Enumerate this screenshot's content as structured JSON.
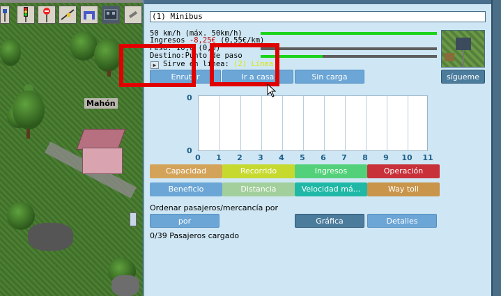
{
  "map": {
    "city_label": "Mahón",
    "toolbar": [
      "road-sign-icon",
      "traffic-light-icon",
      "no-entry-sign-icon",
      "waypoint-icon",
      "depot-icon",
      "station-icon",
      "wrench-icon"
    ]
  },
  "vehicle": {
    "name": "(1) Minibus",
    "speed_line": "50 km/h (máx. 50km/h)",
    "speed_fraction": 1.0,
    "income_prefix": "Ingresos ",
    "income_value": "-8,25€",
    "income_suffix": " (0,55€/km)",
    "weight_line": "Peso: 10,0 (0,0)",
    "weight_fraction": 0.0,
    "destination_line": "Destino:Punto de paso",
    "destination_fraction": 0.35,
    "line_prefix": "Sirve en línea: ",
    "line_value": "(2) Línea"
  },
  "buttons": {
    "route": "Enrutar",
    "go_home": "Ir a casa",
    "no_load": "Sin carga",
    "follow": "sígueme"
  },
  "chart_data": {
    "type": "line",
    "x": [
      0,
      1,
      2,
      3,
      4,
      5,
      6,
      7,
      8,
      9,
      10,
      11
    ],
    "ylim": [
      0,
      0
    ],
    "y_ticks": [
      "0",
      "0"
    ],
    "x_ticks": [
      "0",
      "1",
      "2",
      "3",
      "4",
      "5",
      "6",
      "7",
      "8",
      "9",
      "10",
      "11"
    ],
    "series": []
  },
  "categories": [
    {
      "label": "Capacidad",
      "color": "#d4a35a"
    },
    {
      "label": "Recorrido",
      "color": "#c6d92e"
    },
    {
      "label": "Ingresos",
      "color": "#52d17a"
    },
    {
      "label": "Operación",
      "color": "#c8313a"
    },
    {
      "label": "Beneficio",
      "color": "#6ca6d6"
    },
    {
      "label": "Distancia",
      "color": "#a3cf9c"
    },
    {
      "label": "Velocidad má...",
      "color": "#1fb8a6"
    },
    {
      "label": "Way toll",
      "color": "#c9954a"
    }
  ],
  "sort": {
    "label": "Ordenar pasajeros/mercancía por",
    "by": "por",
    "graph": "Gráfica",
    "details": "Detalles"
  },
  "load_status": "0/39 Pasajeros cargado"
}
